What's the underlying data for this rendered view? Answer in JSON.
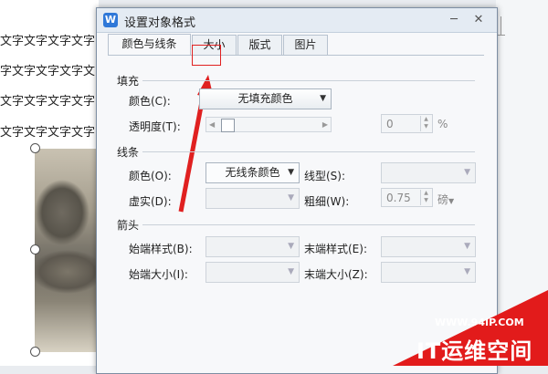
{
  "document": {
    "text_lines": [
      "文字文字文字文字",
      "字文字文字文字文",
      "文字文字文字文字",
      "文字文字文字文字"
    ]
  },
  "dialog": {
    "app_icon": "W",
    "title": "设置对象格式",
    "close_glyph": "✕",
    "minimize_glyph": "─"
  },
  "tabs": [
    {
      "label": "颜色与线条",
      "active": true
    },
    {
      "label": "大小",
      "active": false,
      "highlighted": true
    },
    {
      "label": "版式",
      "active": false
    },
    {
      "label": "图片",
      "active": false
    }
  ],
  "fill": {
    "section_title": "填充",
    "color_label": "颜色(C):",
    "color_value": "无填充颜色",
    "transparency_label": "透明度(T):",
    "transparency_value": "0",
    "transparency_unit": "%"
  },
  "line": {
    "section_title": "线条",
    "color_label": "颜色(O):",
    "color_value": "无线条颜色",
    "style_label": "线型(S):",
    "style_value": "",
    "dash_label": "虚实(D):",
    "dash_value": "",
    "weight_label": "粗细(W):",
    "weight_value": "0.75",
    "weight_unit": "磅"
  },
  "arrows": {
    "section_title": "箭头",
    "begin_style_label": "始端样式(B):",
    "end_style_label": "末端样式(E):",
    "begin_size_label": "始端大小(I):",
    "end_size_label": "末端大小(Z):"
  },
  "watermark": {
    "url": "WWW.94IP.COM",
    "brand": "IT运维空间"
  },
  "colors": {
    "annotation_red": "#e02020",
    "dialog_bg": "#f7f8fa",
    "watermark_red": "#e21b1b"
  }
}
